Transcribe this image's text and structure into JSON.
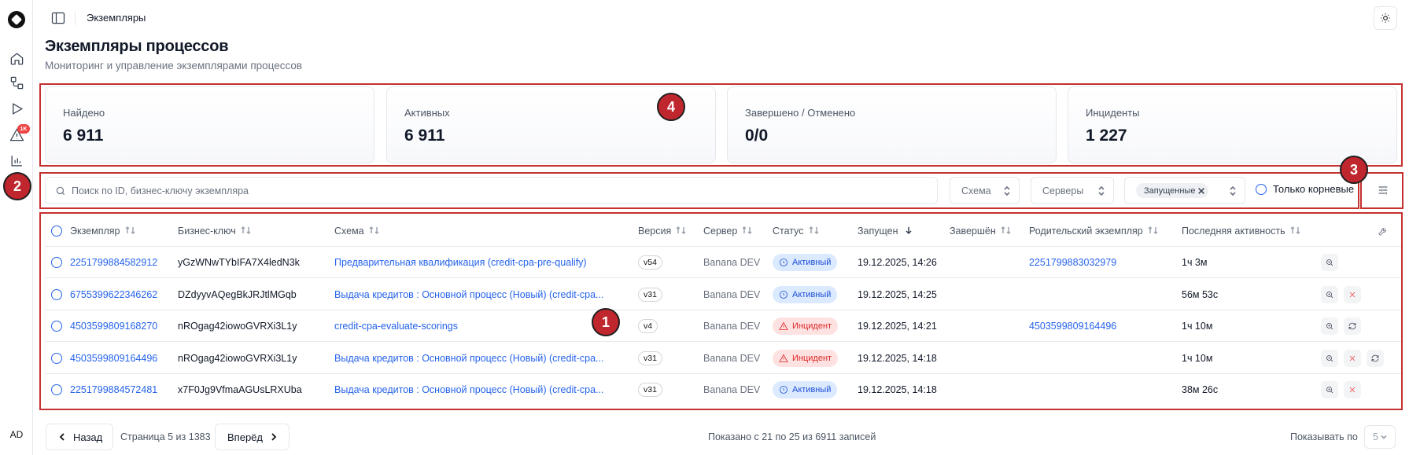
{
  "breadcrumb": "Экземпляры",
  "page": {
    "title": "Экземпляры процессов",
    "subtitle": "Мониторинг и управление экземплярами процессов"
  },
  "sidebar": {
    "badge": "1K",
    "avatar": "AD",
    "icons": [
      "home-icon",
      "diagram-icon",
      "play-icon",
      "alert-icon",
      "chart-icon"
    ]
  },
  "stats": [
    {
      "label": "Найдено",
      "value": "6 911"
    },
    {
      "label": "Активных",
      "value": "6 911"
    },
    {
      "label": "Завершено / Отменено",
      "value": "0/0"
    },
    {
      "label": "Инциденты",
      "value": "1 227"
    }
  ],
  "filters": {
    "search_placeholder": "Поиск по ID, бизнес-ключу экземпляра",
    "schema_label": "Схема",
    "servers_label": "Серверы",
    "status_chip": "Запущенные",
    "only_root_label": "Только корневые"
  },
  "table": {
    "columns": [
      "Экземпляр",
      "Бизнес-ключ",
      "Схема",
      "Версия",
      "Сервер",
      "Статус",
      "Запущен",
      "Завершён",
      "Родительский экземпляр",
      "Последняя активность"
    ],
    "rows": [
      {
        "id": "2251799884582912",
        "key": "yGzWNwTYbIFA7X4ledN3k",
        "schema": "Предварительная квалификация (credit-cpa-pre-qualify)",
        "version": "v54",
        "server": "Banana DEV",
        "status": "Активный",
        "status_type": "active",
        "started": "19.12.2025, 14:26",
        "finished": "",
        "parent": "2251799883032979",
        "last": "1ч 3м",
        "actions": [
          "zoom"
        ]
      },
      {
        "id": "6755399622346262",
        "key": "DZdyyvAQegBkJRJtlMGqb",
        "schema": "Выдача кредитов : Основной процесс (Новый) (credit-cpa...",
        "version": "v31",
        "server": "Banana DEV",
        "status": "Активный",
        "status_type": "active",
        "started": "19.12.2025, 14:25",
        "finished": "",
        "parent": "",
        "last": "56м 53с",
        "actions": [
          "zoom",
          "cancel"
        ]
      },
      {
        "id": "4503599809168270",
        "key": "nROgag42iowoGVRXi3L1y",
        "schema": "credit-cpa-evaluate-scorings",
        "version": "v4",
        "server": "Banana DEV",
        "status": "Инцидент",
        "status_type": "incident",
        "started": "19.12.2025, 14:21",
        "finished": "",
        "parent": "4503599809164496",
        "last": "1ч 10м",
        "actions": [
          "zoom",
          "retry"
        ]
      },
      {
        "id": "4503599809164496",
        "key": "nROgag42iowoGVRXi3L1y",
        "schema": "Выдача кредитов : Основной процесс (Новый) (credit-cpa...",
        "version": "v31",
        "server": "Banana DEV",
        "status": "Инцидент",
        "status_type": "incident",
        "started": "19.12.2025, 14:18",
        "finished": "",
        "parent": "",
        "last": "1ч 10м",
        "actions": [
          "zoom",
          "cancel",
          "retry"
        ]
      },
      {
        "id": "2251799884572481",
        "key": "x7F0Jg9VfmaAGUsLRXUba",
        "schema": "Выдача кредитов : Основной процесс (Новый) (credit-cpa...",
        "version": "v31",
        "server": "Banana DEV",
        "status": "Активный",
        "status_type": "active",
        "started": "19.12.2025, 14:18",
        "finished": "",
        "parent": "",
        "last": "38м 26с",
        "actions": [
          "zoom",
          "cancel"
        ]
      }
    ]
  },
  "pagination": {
    "prev": "Назад",
    "page_info": "Страница 5 из 1383",
    "next": "Вперёд",
    "shown": "Показано с 21 по 25 из 6911 записей",
    "per_page_label": "Показывать по",
    "per_page_value": "5"
  },
  "annotations": [
    "1",
    "2",
    "3",
    "4"
  ],
  "colors": {
    "accent": "#2563eb",
    "annotation": "#c53030",
    "incident": "#dc2626"
  }
}
